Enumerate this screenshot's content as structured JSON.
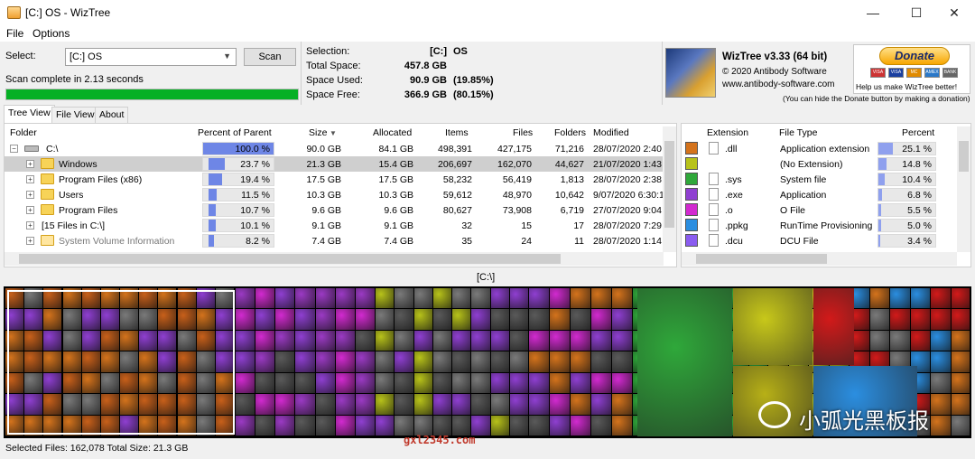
{
  "window": {
    "title": "[C:] OS - WizTree",
    "min": "—",
    "max": "☐",
    "close": "✕"
  },
  "menu": {
    "file": "File",
    "options": "Options"
  },
  "scan": {
    "select_label": "Select:",
    "drive": "[C:] OS",
    "scan_button": "Scan",
    "status": "Scan complete in 2.13 seconds",
    "progress": 1.0
  },
  "stats": {
    "selection_label": "Selection:",
    "selection_value": "[C:]",
    "selection_name": "OS",
    "total_label": "Total Space:",
    "total_value": "457.8 GB",
    "used_label": "Space Used:",
    "used_value": "90.9 GB",
    "used_pct": "(19.85%)",
    "free_label": "Space Free:",
    "free_value": "366.9 GB",
    "free_pct": "(80.15%)"
  },
  "brand": {
    "title": "WizTree v3.33 (64 bit)",
    "copyright": "© 2020 Antibody Software",
    "url": "www.antibody-software.com"
  },
  "donate": {
    "button": "Donate",
    "help": "Help us make WizTree better!",
    "note": "(You can hide the Donate button by making a donation)",
    "cards": [
      "VISA",
      "MC",
      "AMEX",
      "BANK"
    ]
  },
  "tabs": {
    "tree": "Tree View",
    "file": "File View",
    "about": "About"
  },
  "tree": {
    "columns": {
      "folder": "Folder",
      "percent": "Percent of Parent",
      "size": "Size",
      "sort_icon": "▼",
      "allocated": "Allocated",
      "items": "Items",
      "files": "Files",
      "folders": "Folders",
      "modified": "Modified"
    },
    "rows": [
      {
        "name": "C:\\",
        "pct": "100.0 %",
        "frac": 1.0,
        "size": "90.0 GB",
        "alloc": "84.1 GB",
        "items": "498,391",
        "files": "427,175",
        "folders": "71,216",
        "modified": "28/07/2020 2:40"
      },
      {
        "name": "Windows",
        "pct": "23.7 %",
        "frac": 0.237,
        "size": "21.3 GB",
        "alloc": "15.4 GB",
        "items": "206,697",
        "files": "162,070",
        "folders": "44,627",
        "modified": "21/07/2020 1:43"
      },
      {
        "name": "Program Files (x86)",
        "pct": "19.4 %",
        "frac": 0.194,
        "size": "17.5 GB",
        "alloc": "17.5 GB",
        "items": "58,232",
        "files": "56,419",
        "folders": "1,813",
        "modified": "28/07/2020 2:38"
      },
      {
        "name": "Users",
        "pct": "11.5 %",
        "frac": 0.115,
        "size": "10.3 GB",
        "alloc": "10.3 GB",
        "items": "59,612",
        "files": "48,970",
        "folders": "10,642",
        "modified": "9/07/2020 6:30:1"
      },
      {
        "name": "Program Files",
        "pct": "10.7 %",
        "frac": 0.107,
        "size": "9.6 GB",
        "alloc": "9.6 GB",
        "items": "80,627",
        "files": "73,908",
        "folders": "6,719",
        "modified": "27/07/2020 9:04"
      },
      {
        "name": "[15 Files in C:\\]",
        "pct": "10.1 %",
        "frac": 0.101,
        "size": "9.1 GB",
        "alloc": "9.1 GB",
        "items": "32",
        "files": "15",
        "folders": "17",
        "modified": "28/07/2020 7:29"
      },
      {
        "name": "System Volume Information",
        "pct": "8.2 %",
        "frac": 0.082,
        "size": "7.4 GB",
        "alloc": "7.4 GB",
        "items": "35",
        "files": "24",
        "folders": "11",
        "modified": "28/07/2020 1:14"
      }
    ]
  },
  "extensions": {
    "columns": {
      "extension": "Extension",
      "type": "File Type",
      "percent": "Percent"
    },
    "rows": [
      {
        "ext": ".dll",
        "type": "Application extension",
        "pct": "25.1 %",
        "frac": 0.251,
        "color": "#d4731c"
      },
      {
        "ext": "",
        "type": "(No Extension)",
        "pct": "14.8 %",
        "frac": 0.148,
        "color": "#b7c21a"
      },
      {
        "ext": ".sys",
        "type": "System file",
        "pct": "10.4 %",
        "frac": 0.104,
        "color": "#2fa83a"
      },
      {
        "ext": ".exe",
        "type": "Application",
        "pct": "6.8 %",
        "frac": 0.068,
        "color": "#8f3fd1"
      },
      {
        "ext": ".o",
        "type": "O File",
        "pct": "5.5 %",
        "frac": 0.055,
        "color": "#d22ad0"
      },
      {
        "ext": ".ppkg",
        "type": "RunTime Provisioning To",
        "pct": "5.0 %",
        "frac": 0.05,
        "color": "#2b8ee0"
      },
      {
        "ext": ".dcu",
        "type": "DCU File",
        "pct": "3.4 %",
        "frac": 0.034,
        "color": "#8a5cf0"
      }
    ]
  },
  "treemap": {
    "path": "[C:\\]"
  },
  "status": "Selected Files: 162,078  Total Size: 21.3 GB",
  "watermark": {
    "url": "gxl2345.com",
    "text": "小弧光黑板报"
  }
}
